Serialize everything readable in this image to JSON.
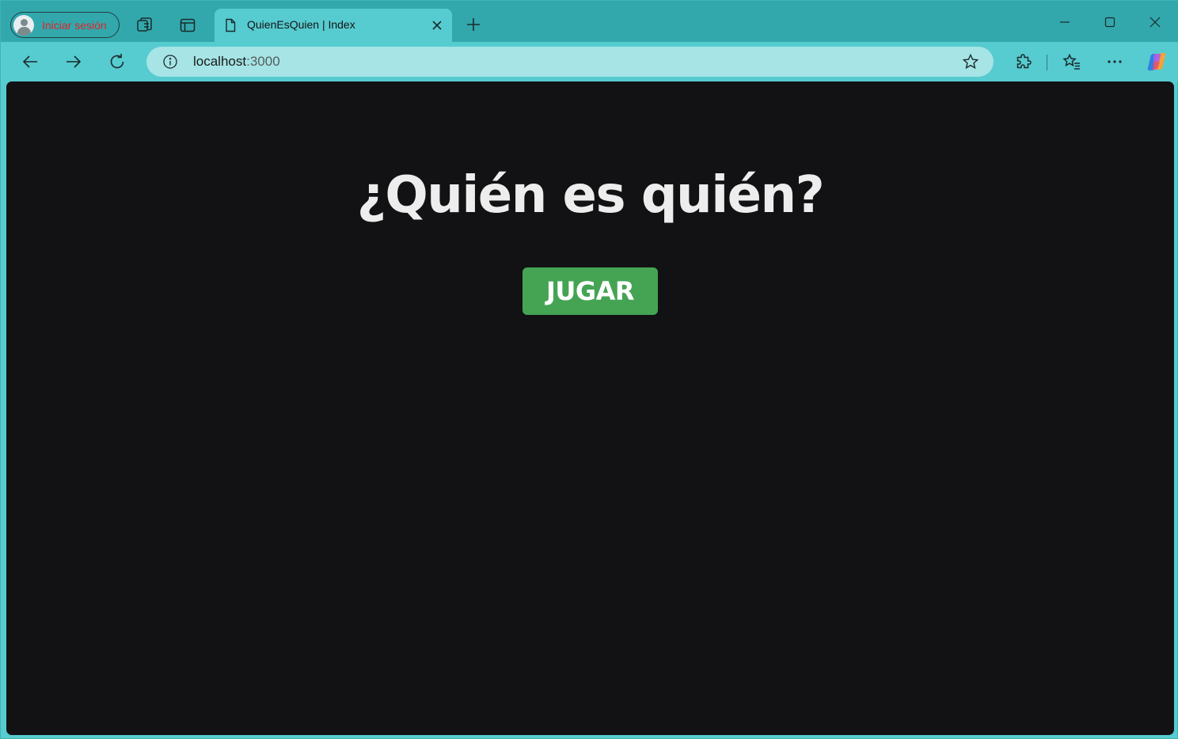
{
  "browser": {
    "profile": {
      "label": "Iniciar sesión",
      "avatar_icon": "person-icon"
    },
    "tab": {
      "title": "QuienEsQuien | Index",
      "icon": "page-icon"
    },
    "address": {
      "host": "localhost",
      "port": ":3000"
    },
    "colors": {
      "frame": "#32a8ac",
      "toolbar": "#56cbd0",
      "address_bar": "#a6e4e5",
      "profile_label": "#d9262c"
    }
  },
  "page": {
    "title": "¿Quién es quién?",
    "play_button": "JUGAR",
    "colors": {
      "background": "#121214",
      "title": "#ededee",
      "button": "#45a454",
      "button_text": "#ffffff"
    }
  }
}
